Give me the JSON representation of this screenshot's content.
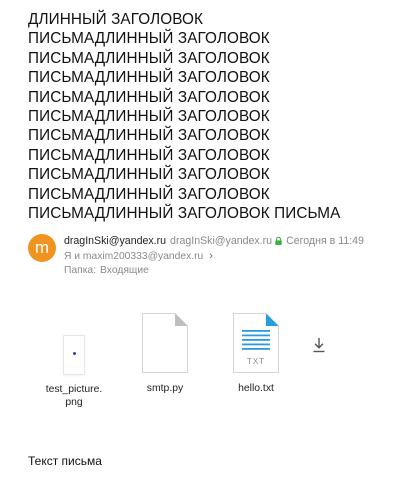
{
  "message": {
    "subject_lines": [
      "ДЛИННЫЙ ЗАГОЛОВОК",
      "ПИСЬМАДЛИННЫЙ ЗАГОЛОВОК",
      "ПИСЬМАДЛИННЫЙ ЗАГОЛОВОК",
      "ПИСЬМАДЛИННЫЙ ЗАГОЛОВОК",
      "ПИСЬМАДЛИННЫЙ ЗАГОЛОВОК",
      "ПИСЬМАДЛИННЫЙ ЗАГОЛОВОК",
      "ПИСЬМАДЛИННЫЙ ЗАГОЛОВОК",
      "ПИСЬМАДЛИННЫЙ ЗАГОЛОВОК",
      "ПИСЬМАДЛИННЫЙ ЗАГОЛОВОК",
      "ПИСЬМАДЛИННЫЙ ЗАГОЛОВОК",
      "ПИСЬМАДЛИННЫЙ ЗАГОЛОВОК ПИСЬМА"
    ],
    "sender": {
      "avatar_letter": "m",
      "avatar_color": "#f0931f",
      "name": "dragInSki@yandex.ru",
      "email": "dragInSki@yandex.ru",
      "verified_icon": "lock-icon",
      "verified_color": "#3cb043"
    },
    "date": "Сегодня в 11:49",
    "recipients": "Я и maxim200333@yandex.ru",
    "folder": {
      "label": "Папка:",
      "value": "Входящие"
    },
    "attachments": [
      {
        "name_line1": "test_picture.",
        "name_line2": "png",
        "kind": "image"
      },
      {
        "name": "smtp.py",
        "kind": "generic-file-icon"
      },
      {
        "name": "hello.txt",
        "kind": "text-file-icon",
        "type_label": "TXT",
        "accent_color": "#2b9be0"
      }
    ],
    "download_all_icon": "download-icon",
    "body": "Текст письма"
  }
}
